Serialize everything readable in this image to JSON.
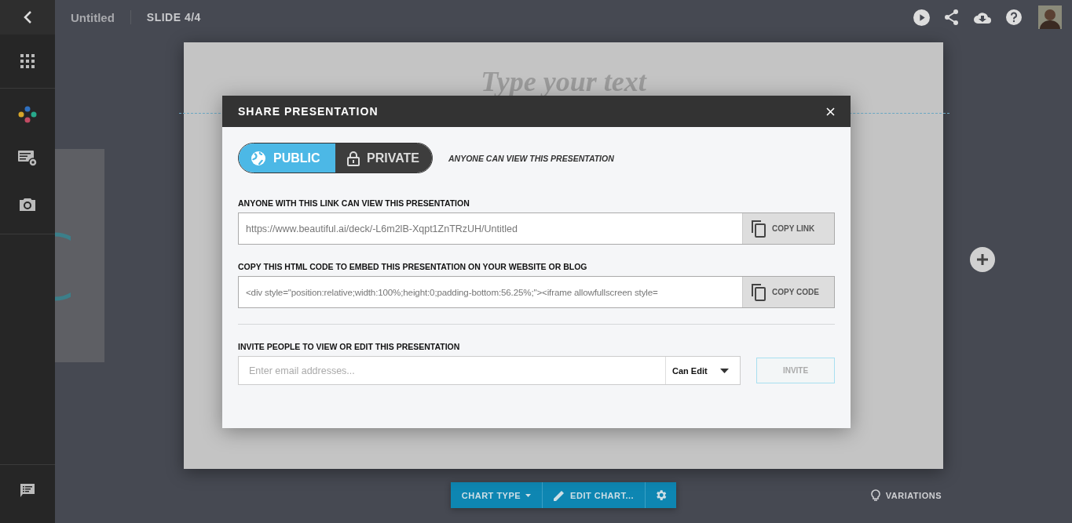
{
  "document": {
    "title": "Untitled",
    "slide_indicator": "SLIDE 4/4"
  },
  "slide": {
    "title_placeholder": "Type your text"
  },
  "dialog": {
    "title": "SHARE PRESENTATION",
    "visibility": [
      {
        "label": "PUBLIC",
        "selected": true
      },
      {
        "label": "PRIVATE",
        "selected": false
      }
    ],
    "visibility_note": "ANYONE CAN VIEW THIS PRESENTATION",
    "link": {
      "label": "ANYONE WITH THIS LINK CAN VIEW THIS PRESENTATION",
      "value": "https://www.beautiful.ai/deck/-L6m2lB-Xqpt1ZnTRzUH/Untitled",
      "button": "COPY LINK"
    },
    "embed": {
      "label": "COPY THIS HTML CODE TO EMBED THIS PRESENTATION ON YOUR WEBSITE OR BLOG",
      "value": "<div style=\"position:relative;width:100%;height:0;padding-bottom:56.25%;\"><iframe allowfullscreen style=",
      "button": "COPY CODE"
    },
    "invite": {
      "label": "INVITE PEOPLE TO VIEW OR EDIT THIS PRESENTATION",
      "placeholder": "Enter email addresses...",
      "permission": "Can Edit",
      "button": "INVITE",
      "disabled": true
    }
  },
  "toolbar": {
    "buttons": [
      "CHART TYPE",
      "EDIT CHART..."
    ],
    "variations": "VARIATIONS"
  }
}
